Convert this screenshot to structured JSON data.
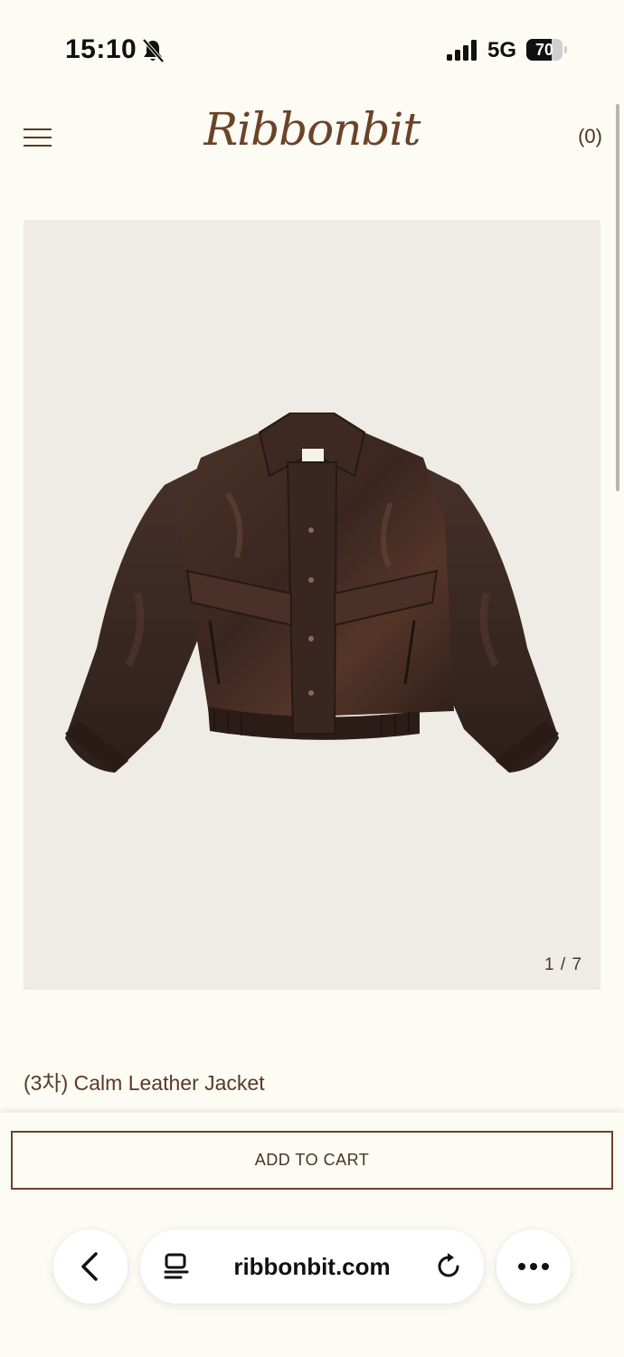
{
  "status_bar": {
    "time": "15:10",
    "network": "5G",
    "battery_percent": 70,
    "battery_label": "70",
    "icons": [
      "bell-muted-icon",
      "signal-icon",
      "battery-icon"
    ]
  },
  "header": {
    "logo_text": "Ribbonbit",
    "cart_label": "(0)",
    "menu_icon": "hamburger-menu-icon"
  },
  "gallery": {
    "counter": "1 / 7",
    "image": "brown-leather-jacket",
    "background_color": "#eeece4"
  },
  "product": {
    "title": "(3차) Calm Leather Jacket"
  },
  "cart_bar": {
    "add_to_cart_label": "ADD TO CART"
  },
  "browser": {
    "url": "ribbonbit.com",
    "icons": [
      "back-arrow-icon",
      "reader-mode-icon",
      "reload-icon",
      "more-icon"
    ]
  },
  "colors": {
    "page_background": "#fcfbf4",
    "brand_brown": "#6b4329",
    "text_brown": "#5a3a24"
  }
}
